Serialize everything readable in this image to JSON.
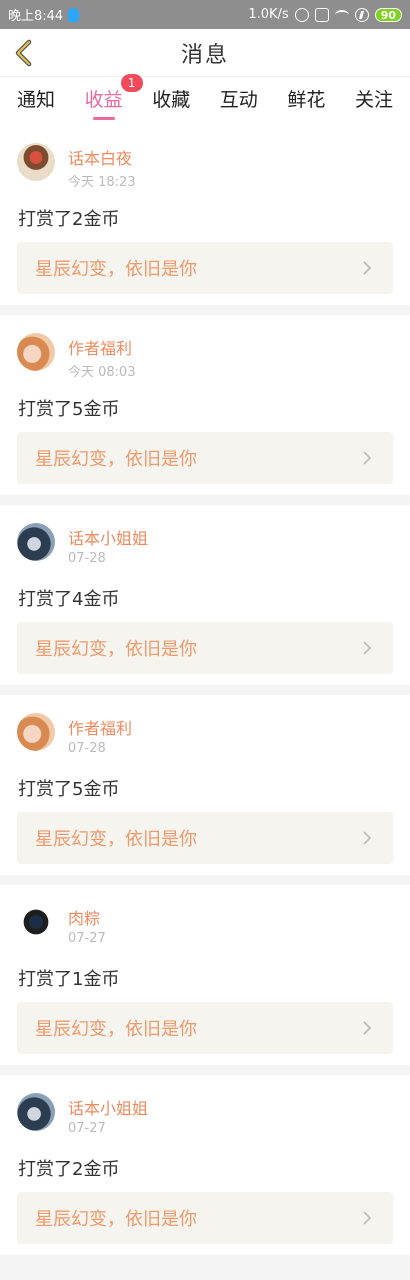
{
  "status_bar": {
    "time": "晚上8:44",
    "speed": "1.0K/s",
    "battery": "90"
  },
  "header": {
    "title": "消息"
  },
  "tabs": [
    {
      "label": "通知",
      "active": false
    },
    {
      "label": "收益",
      "active": true,
      "badge": "1"
    },
    {
      "label": "收藏",
      "active": false
    },
    {
      "label": "互动",
      "active": false
    },
    {
      "label": "鲜花",
      "active": false
    },
    {
      "label": "关注",
      "active": false
    }
  ],
  "colors": {
    "accent": "#e86aa1",
    "username": "#f08a5d",
    "book_title": "#f0996c",
    "badge": "#f24a5a"
  },
  "items": [
    {
      "user": "话本白夜",
      "time": "今天 18:23",
      "message": "打赏了2金币",
      "book": "星辰幻变，依旧是你",
      "avatar": "av0"
    },
    {
      "user": "作者福利",
      "time": "今天 08:03",
      "message": "打赏了5金币",
      "book": "星辰幻变，依旧是你",
      "avatar": "av1"
    },
    {
      "user": "话本小姐姐",
      "time": "07-28",
      "message": "打赏了4金币",
      "book": "星辰幻变，依旧是你",
      "avatar": "av2"
    },
    {
      "user": "作者福利",
      "time": "07-28",
      "message": "打赏了5金币",
      "book": "星辰幻变，依旧是你",
      "avatar": "av1"
    },
    {
      "user": "肉粽",
      "time": "07-27",
      "message": "打赏了1金币",
      "book": "星辰幻变，依旧是你",
      "avatar": "av3"
    },
    {
      "user": "话本小姐姐",
      "time": "07-27",
      "message": "打赏了2金币",
      "book": "星辰幻变，依旧是你",
      "avatar": "av2"
    }
  ]
}
